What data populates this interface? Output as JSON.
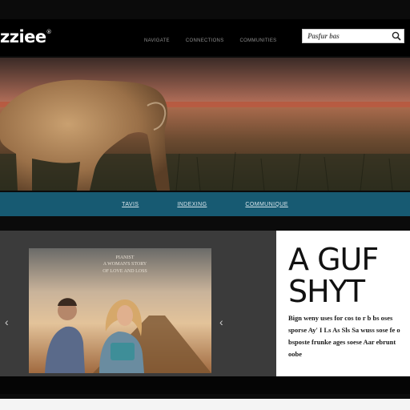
{
  "brand": {
    "name": "zziee",
    "mark": "®"
  },
  "nav": {
    "items": [
      "NAVIGATE",
      "CONNECTIONS",
      "COMMUNITIES"
    ]
  },
  "search": {
    "placeholder": "Pasfur bas",
    "icon": "search-icon"
  },
  "hero": {
    "icon": "hero-landscape-image"
  },
  "strip": {
    "items": [
      "TAVIS",
      "INDEXING",
      "COMMUNIQUE"
    ]
  },
  "feature": {
    "poster_caption": "PIANIST\nA WOMAN'S STORY\nOF LOVE AND LOSS",
    "headline": "A GUF\nSHYT",
    "body": "Bign weny uses for cos to r b bs oses sporse Ay' I Ls As Sls Sa wuss sose fe o bsposte frunke ages soese Aar ebrunt oobe",
    "prev_icon": "chevron-left-icon",
    "next_icon": "chevron-left-icon"
  },
  "colors": {
    "strip": "#175a72",
    "frame": "#0b0b0b",
    "panel": "#3b3b3b"
  }
}
